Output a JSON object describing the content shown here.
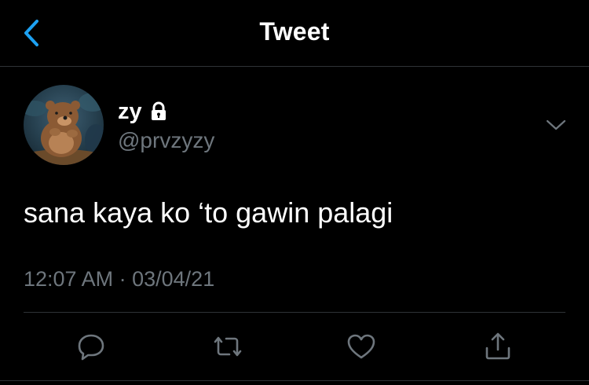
{
  "header": {
    "title": "Tweet",
    "back_icon": "chevron-left-icon"
  },
  "tweet": {
    "author": {
      "display_name": "zy",
      "handle": "@prvzyzy",
      "protected_icon": "lock-icon"
    },
    "text": "sana kaya ko ‘to gawin palagi",
    "time": "12:07 AM",
    "separator": "·",
    "date": "03/04/21"
  },
  "actions": [
    {
      "name": "reply",
      "icon": "reply-icon"
    },
    {
      "name": "retweet",
      "icon": "retweet-icon"
    },
    {
      "name": "like",
      "icon": "heart-icon"
    },
    {
      "name": "share",
      "icon": "share-icon"
    }
  ],
  "colors": {
    "background": "#000000",
    "primary_text": "#ffffff",
    "secondary_text": "#6e767d",
    "accent": "#1da1f2",
    "divider": "#2f3336"
  }
}
